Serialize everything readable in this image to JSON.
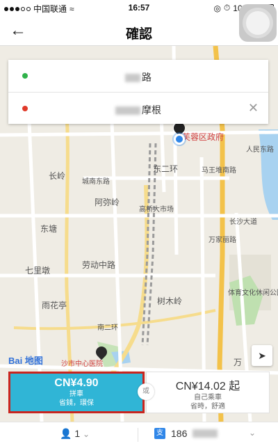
{
  "status_bar": {
    "carrier": "中国联通",
    "time": "16:57",
    "battery": "100%"
  },
  "nav": {
    "title": "確認"
  },
  "route": {
    "pickup_suffix": "路",
    "dropoff_suffix": "摩根",
    "pickup_color": "#2fb24a",
    "dropoff_color": "#e03a2a"
  },
  "map_labels": {
    "furong": "芙蓉区政府",
    "renmin": "人民东路",
    "changling": "长岭",
    "chengnan": "城南东路",
    "dongerhuan": "东二环",
    "maanshan": "马王堆南路",
    "amiling": "阿弥岭",
    "gaoqiao": "高桥大市场",
    "changsha_ave": "长沙大道",
    "dongtang": "东塘",
    "qilidun": "七里墩",
    "laodong": "劳动中路",
    "wanjiali": "万家丽路",
    "yuhua": "雨花亭",
    "shumuling": "树木岭",
    "tiyu": "体育文化休闲公园",
    "nanerhuan": "南二环",
    "hospital": "沙市中心医院",
    "wan": "万"
  },
  "map_brand": "Bai 地图",
  "options": {
    "pool": {
      "price": "CN¥4.90",
      "name": "拼車",
      "desc": "省錢，環保"
    },
    "or_label": "或",
    "solo": {
      "price": "CN¥14.02 起",
      "name": "自己乘車",
      "desc": "省時，舒適"
    }
  },
  "bottom": {
    "seats": "1",
    "phone_prefix": "186"
  },
  "colors": {
    "accent": "#30b5d6",
    "highlight_border": "#c9251f"
  }
}
